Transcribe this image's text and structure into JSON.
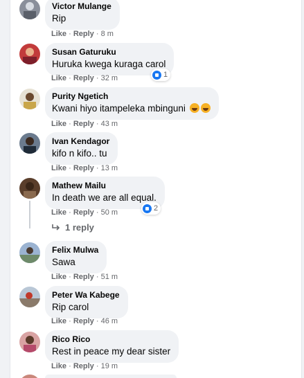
{
  "comments": [
    {
      "author": "Victor Mulange",
      "text": "Rip",
      "action_like": "Like",
      "action_reply": "Reply",
      "time": "8 m"
    },
    {
      "author": "Susan Gaturuku",
      "text": "Huruka kwega kuraga carol",
      "action_like": "Like",
      "action_reply": "Reply",
      "time": "32 m",
      "reaction_count": "1"
    },
    {
      "author": "Purity Ngetich",
      "text": "Kwani hiyo itampeleka mbinguni",
      "action_like": "Like",
      "action_reply": "Reply",
      "time": "43 m"
    },
    {
      "author": "Ivan Kendagor",
      "text": "kifo n kifo.. tu",
      "action_like": "Like",
      "action_reply": "Reply",
      "time": "13 m"
    },
    {
      "author": "Mathew Mailu",
      "text": "In death we are all equal.",
      "action_like": "Like",
      "action_reply": "Reply",
      "time": "50 m",
      "reaction_count": "2",
      "replies_label": "1 reply"
    },
    {
      "author": "Felix Mulwa",
      "text": "Sawa",
      "action_like": "Like",
      "action_reply": "Reply",
      "time": "51 m"
    },
    {
      "author": "Peter Wa Kabege",
      "text": "Rip carol",
      "action_like": "Like",
      "action_reply": "Reply",
      "time": "46 m"
    },
    {
      "author": "Rico Rico",
      "text": "Rest in peace my dear sister",
      "action_like": "Like",
      "action_reply": "Reply",
      "time": "19 m"
    }
  ],
  "separator": "·",
  "colors": {
    "like_blue": "#1877f2",
    "bubble": "#f0f2f5",
    "meta": "#65676b"
  },
  "icons": {
    "reaction": "like-icon",
    "emoji": "laughing-emoji-icon",
    "reply_arrow": "reply-arrow-icon"
  }
}
